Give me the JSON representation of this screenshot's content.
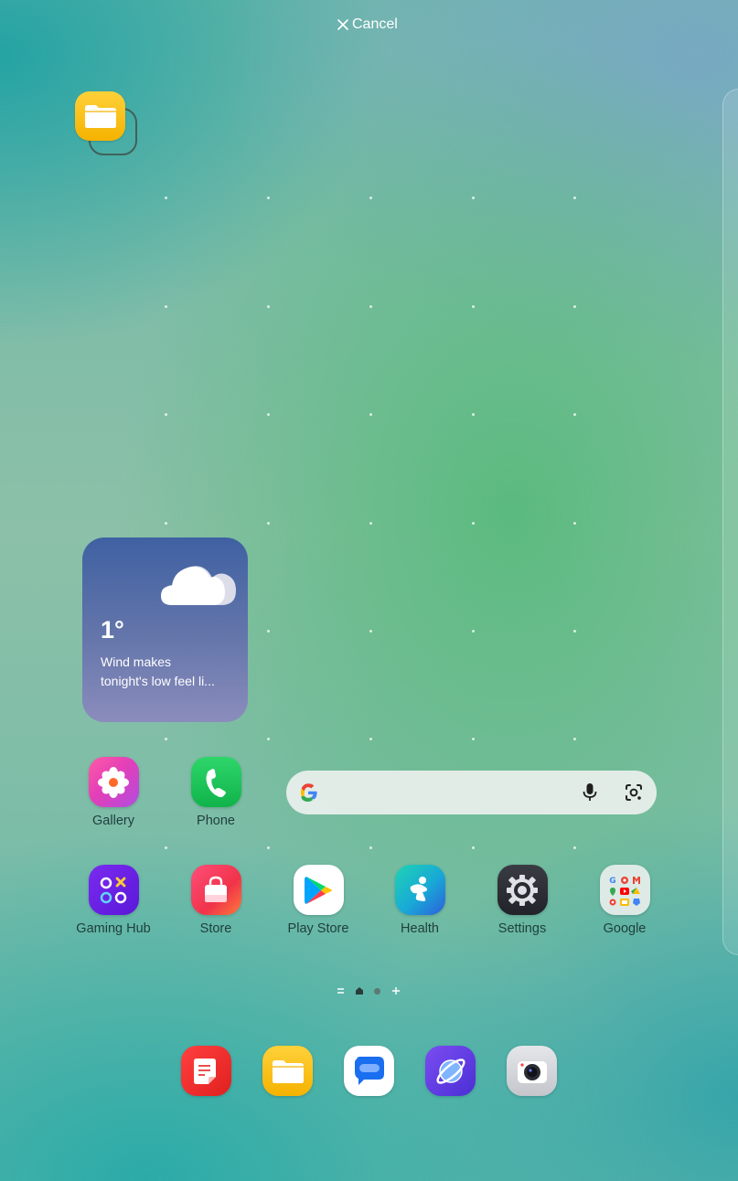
{
  "top_bar": {
    "cancel_label": "Cancel"
  },
  "weather_widget": {
    "temperature": "1°",
    "description_line1": "Wind makes",
    "description_line2": "tonight's low feel li..."
  },
  "apps_row1": [
    {
      "label": "Gallery",
      "icon": "gallery-flower-icon"
    },
    {
      "label": "Phone",
      "icon": "phone-handset-icon"
    }
  ],
  "apps_row2": [
    {
      "label": "Gaming Hub",
      "icon": "gaming-hub-icon"
    },
    {
      "label": "Store",
      "icon": "shopping-bag-icon"
    },
    {
      "label": "Play Store",
      "icon": "play-triangle-icon"
    },
    {
      "label": "Health",
      "icon": "health-runner-icon"
    },
    {
      "label": "Settings",
      "icon": "gear-icon"
    },
    {
      "label": "Google",
      "icon": "google-folder-icon"
    }
  ],
  "search_widget": {
    "icons": [
      "google-g-icon",
      "microphone-icon",
      "lens-camera-icon"
    ]
  },
  "dock": [
    {
      "icon": "notes-icon"
    },
    {
      "icon": "my-files-folder-icon"
    },
    {
      "icon": "messages-icon"
    },
    {
      "icon": "internet-browser-icon"
    },
    {
      "icon": "camera-icon"
    }
  ],
  "dragged_item": {
    "icon": "my-files-folder-icon"
  },
  "colors": {
    "weather_top": "#3f61a2",
    "weather_bottom": "#8b8dbc",
    "label_text": "#1f3e3a"
  }
}
